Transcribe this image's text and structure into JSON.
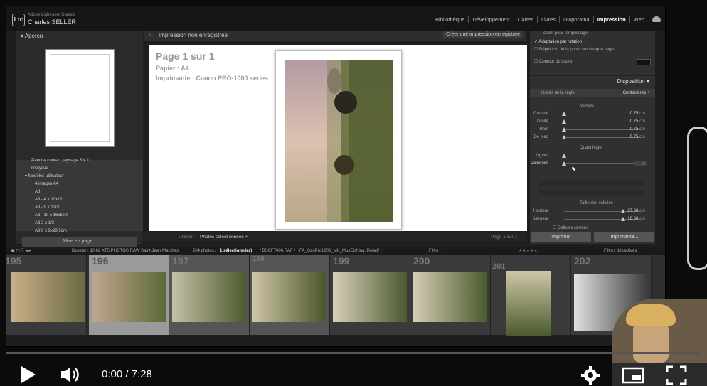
{
  "app": {
    "brand_small": "Adobe Lightroom Classic",
    "user_name": "Charles SELLER",
    "modules": [
      "Bibliothèque",
      "Développement",
      "Cartes",
      "Livres",
      "Diaporama",
      "Impression",
      "Web"
    ],
    "active_module": "Impression"
  },
  "left_panel": {
    "title": "Aperçu",
    "templates": [
      "Planche contact paysage 5 x 11",
      "Triptyque",
      "Modèles utilisateur",
      "4 images A4",
      "A3",
      "A3 - 4 x 10x12",
      "A3 - 9 x 1200",
      "A3 - 10 x 16x6cm",
      "A3 2 x 1/2",
      "A3 8 x 9x93.5cm"
    ],
    "page_setup_button": "Mise en page..."
  },
  "center": {
    "header_title": "Impression non enregistrée",
    "create_button": "Créer une impression enregistrée",
    "page_info_1": "Page 1 sur 1",
    "page_info_2": "Papier : A4",
    "page_info_3": "Imprimante : Canon PRO-1000 series",
    "footer_use_label": "Utiliser :",
    "footer_use_value": "Photos sélectionnées ÷",
    "footer_page": "Page 1 sur 1"
  },
  "right_panel": {
    "opt1": "Zoom pour remplissage",
    "opt2": "Adaptation par rotation",
    "opt3": "Répétition de la photo sur chaque page",
    "opt4": "Contour du cadre",
    "section_title": "Disposition",
    "units_label": "Unités de la règle",
    "units_value": "Centimètres ÷",
    "margins_title": "Marges",
    "margins": [
      {
        "label": "Gauche",
        "value": "0.75",
        "unit": "cm"
      },
      {
        "label": "Droite",
        "value": "0.75",
        "unit": "cm"
      },
      {
        "label": "Haut",
        "value": "0.75",
        "unit": "cm"
      },
      {
        "label": "De pied",
        "value": "0.75",
        "unit": "cm"
      }
    ],
    "grid_title": "Quadrillage",
    "grid": [
      {
        "label": "Lignes",
        "value": "1"
      },
      {
        "label": "Colonnes",
        "value": "1"
      }
    ],
    "cell_size_title": "Taille des cellules",
    "cell_size": [
      {
        "label": "Hauteur",
        "value": "27.00",
        "unit": "cm"
      },
      {
        "label": "Largeur",
        "value": "18.00",
        "unit": "cm"
      }
    ],
    "square_cells": "Cellules carrées",
    "print_button": "Imprimer",
    "printer_button": "Imprimante..."
  },
  "filmstrip": {
    "path": "Dossier : 10.02 XT5 PHOTOS RAW Saint Jean Marshes",
    "count": "204 photos /",
    "selected": "1 sélectionné(s)",
    "file": "/ DSCF7000.RAF / HFA_CanPro1000_MK_MusEtching, Relatif ÷",
    "filter_label": "Filtre :",
    "filters_off": "Filtres désactivés",
    "numbers": [
      "195",
      "196",
      "197",
      "198",
      "199",
      "200",
      "201",
      "202"
    ]
  },
  "player": {
    "time": "0:00 / 7:28",
    "progress": 0
  }
}
